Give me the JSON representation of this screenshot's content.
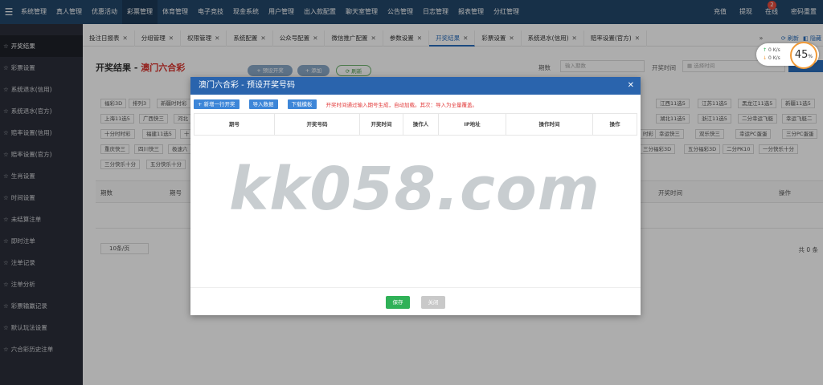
{
  "topnav": {
    "items": [
      "系统管理",
      "真人管理",
      "优惠活动",
      "彩票管理",
      "体育管理",
      "电子竞技",
      "现金系统",
      "用户管理",
      "出入款配置",
      "聊天室管理",
      "公告管理",
      "日志管理",
      "报表管理",
      "分红管理"
    ],
    "active_index": 3,
    "right": [
      "充值",
      "提现",
      "在线",
      "密码重置"
    ],
    "online_badge": "2"
  },
  "sidebar": {
    "items": [
      "开奖结果",
      "彩票设置",
      "系统退水(信用)",
      "系统退水(官方)",
      "赔率设置(信用)",
      "赔率设置(官方)",
      "生肖设置",
      "时间设置",
      "未结算注单",
      "即时注单",
      "注单记录",
      "注单分析",
      "彩票输赢记录",
      "默认玩法设置",
      "六合彩历史注单"
    ],
    "active_index": 0
  },
  "tabs": {
    "items": [
      "投注日报表",
      "分组管理",
      "权限管理",
      "系统配置",
      "公众号配置",
      "微信推广配置",
      "参数设置",
      "开奖结果",
      "彩票设置",
      "系统退水(信用)",
      "赔率设置(官方)"
    ],
    "active_index": 7,
    "more": "»",
    "refresh": "刷新",
    "hide": "隐藏"
  },
  "page": {
    "title": "开奖结果 - ",
    "title_lottery": "澳门六合彩",
    "btn_preset": "+ 预设开奖",
    "btn_add": "+ 添加",
    "btn_refresh": "刷新",
    "issue_label": "期数",
    "issue_placeholder": "输入期数",
    "time_label": "开奖时间",
    "time_placeholder": "选择时间"
  },
  "chips": [
    "福彩3D",
    "排列3",
    "新疆时时彩",
    "江西11选5",
    "江苏11选5",
    "黑龙江11选5",
    "新疆11选5",
    "上海11选5",
    "广西快三",
    "河北",
    "湖北11选5",
    "浙江11选5",
    "二分幸运飞艇",
    "幸运飞艇二",
    "十分时时彩",
    "福建11选5",
    "十",
    "时彩",
    "幸运快三",
    "双乐快三",
    "幸运PC蛋蛋",
    "三分PC蛋蛋",
    "重庆快三",
    "四川快三",
    "极速六",
    "三分福彩3D",
    "五分福彩3D",
    "二分PK10",
    "一分快乐十分",
    "三分快乐十分",
    "五分快乐十分"
  ],
  "table": {
    "headers": [
      "期数",
      "期号",
      "开奖时间",
      "操作"
    ]
  },
  "pager": {
    "page_size": "10条/页",
    "total": "共 0 条"
  },
  "widget": {
    "up": "0",
    "down": "0",
    "unit": "K/s",
    "percent": "45",
    "percent_sign": "%"
  },
  "modal": {
    "title": "澳门六合彩 - 预设开奖号码",
    "btn_add_row": "+ 新增一行开奖",
    "btn_import": "导入数据",
    "btn_template": "下载模板",
    "tip": "开奖时间通过输入期号生成，自动加载。其次：导入为全量覆盖。",
    "headers": [
      "期号",
      "开奖号码",
      "开奖时间",
      "操作人",
      "IP地址",
      "操作时间",
      "操作"
    ],
    "save": "保存",
    "close": "关闭"
  },
  "watermark": "kk058.com"
}
